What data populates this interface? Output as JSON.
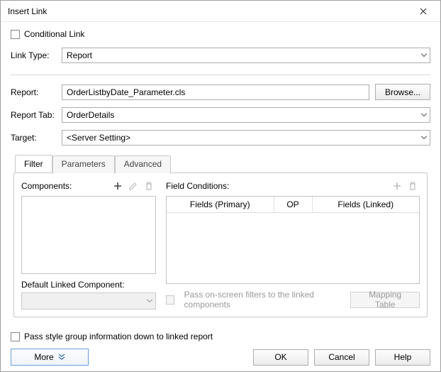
{
  "window": {
    "title": "Insert Link"
  },
  "conditional_link_label": "Conditional Link",
  "link_type": {
    "label": "Link Type:",
    "value": "Report"
  },
  "report": {
    "label": "Report:",
    "value": "OrderListbyDate_Parameter.cls",
    "browse": "Browse..."
  },
  "report_tab": {
    "label": "Report Tab:",
    "value": "OrderDetails"
  },
  "target": {
    "label": "Target:",
    "value": "<Server Setting>"
  },
  "tabs": {
    "filter": "Filter",
    "parameters": "Parameters",
    "advanced": "Advanced"
  },
  "filter_tab": {
    "components_label": "Components:",
    "default_linked_label": "Default Linked Component:",
    "default_linked_value": "",
    "field_conditions_label": "Field Conditions:",
    "table_headers": {
      "primary": "Fields (Primary)",
      "op": "OP",
      "linked": "Fields (Linked)"
    },
    "pass_filters_label": "Pass on-screen filters to the linked components",
    "mapping_table": "Mapping Table"
  },
  "pass_style_label": "Pass style group information down to linked report",
  "buttons": {
    "more": "More",
    "ok": "OK",
    "cancel": "Cancel",
    "help": "Help"
  },
  "icons": {
    "close": "close-icon",
    "add": "plus-icon",
    "edit": "pencil-icon",
    "delete": "trash-icon",
    "caret": "chevron-down-icon",
    "chev2": "double-chevron-down-icon"
  }
}
